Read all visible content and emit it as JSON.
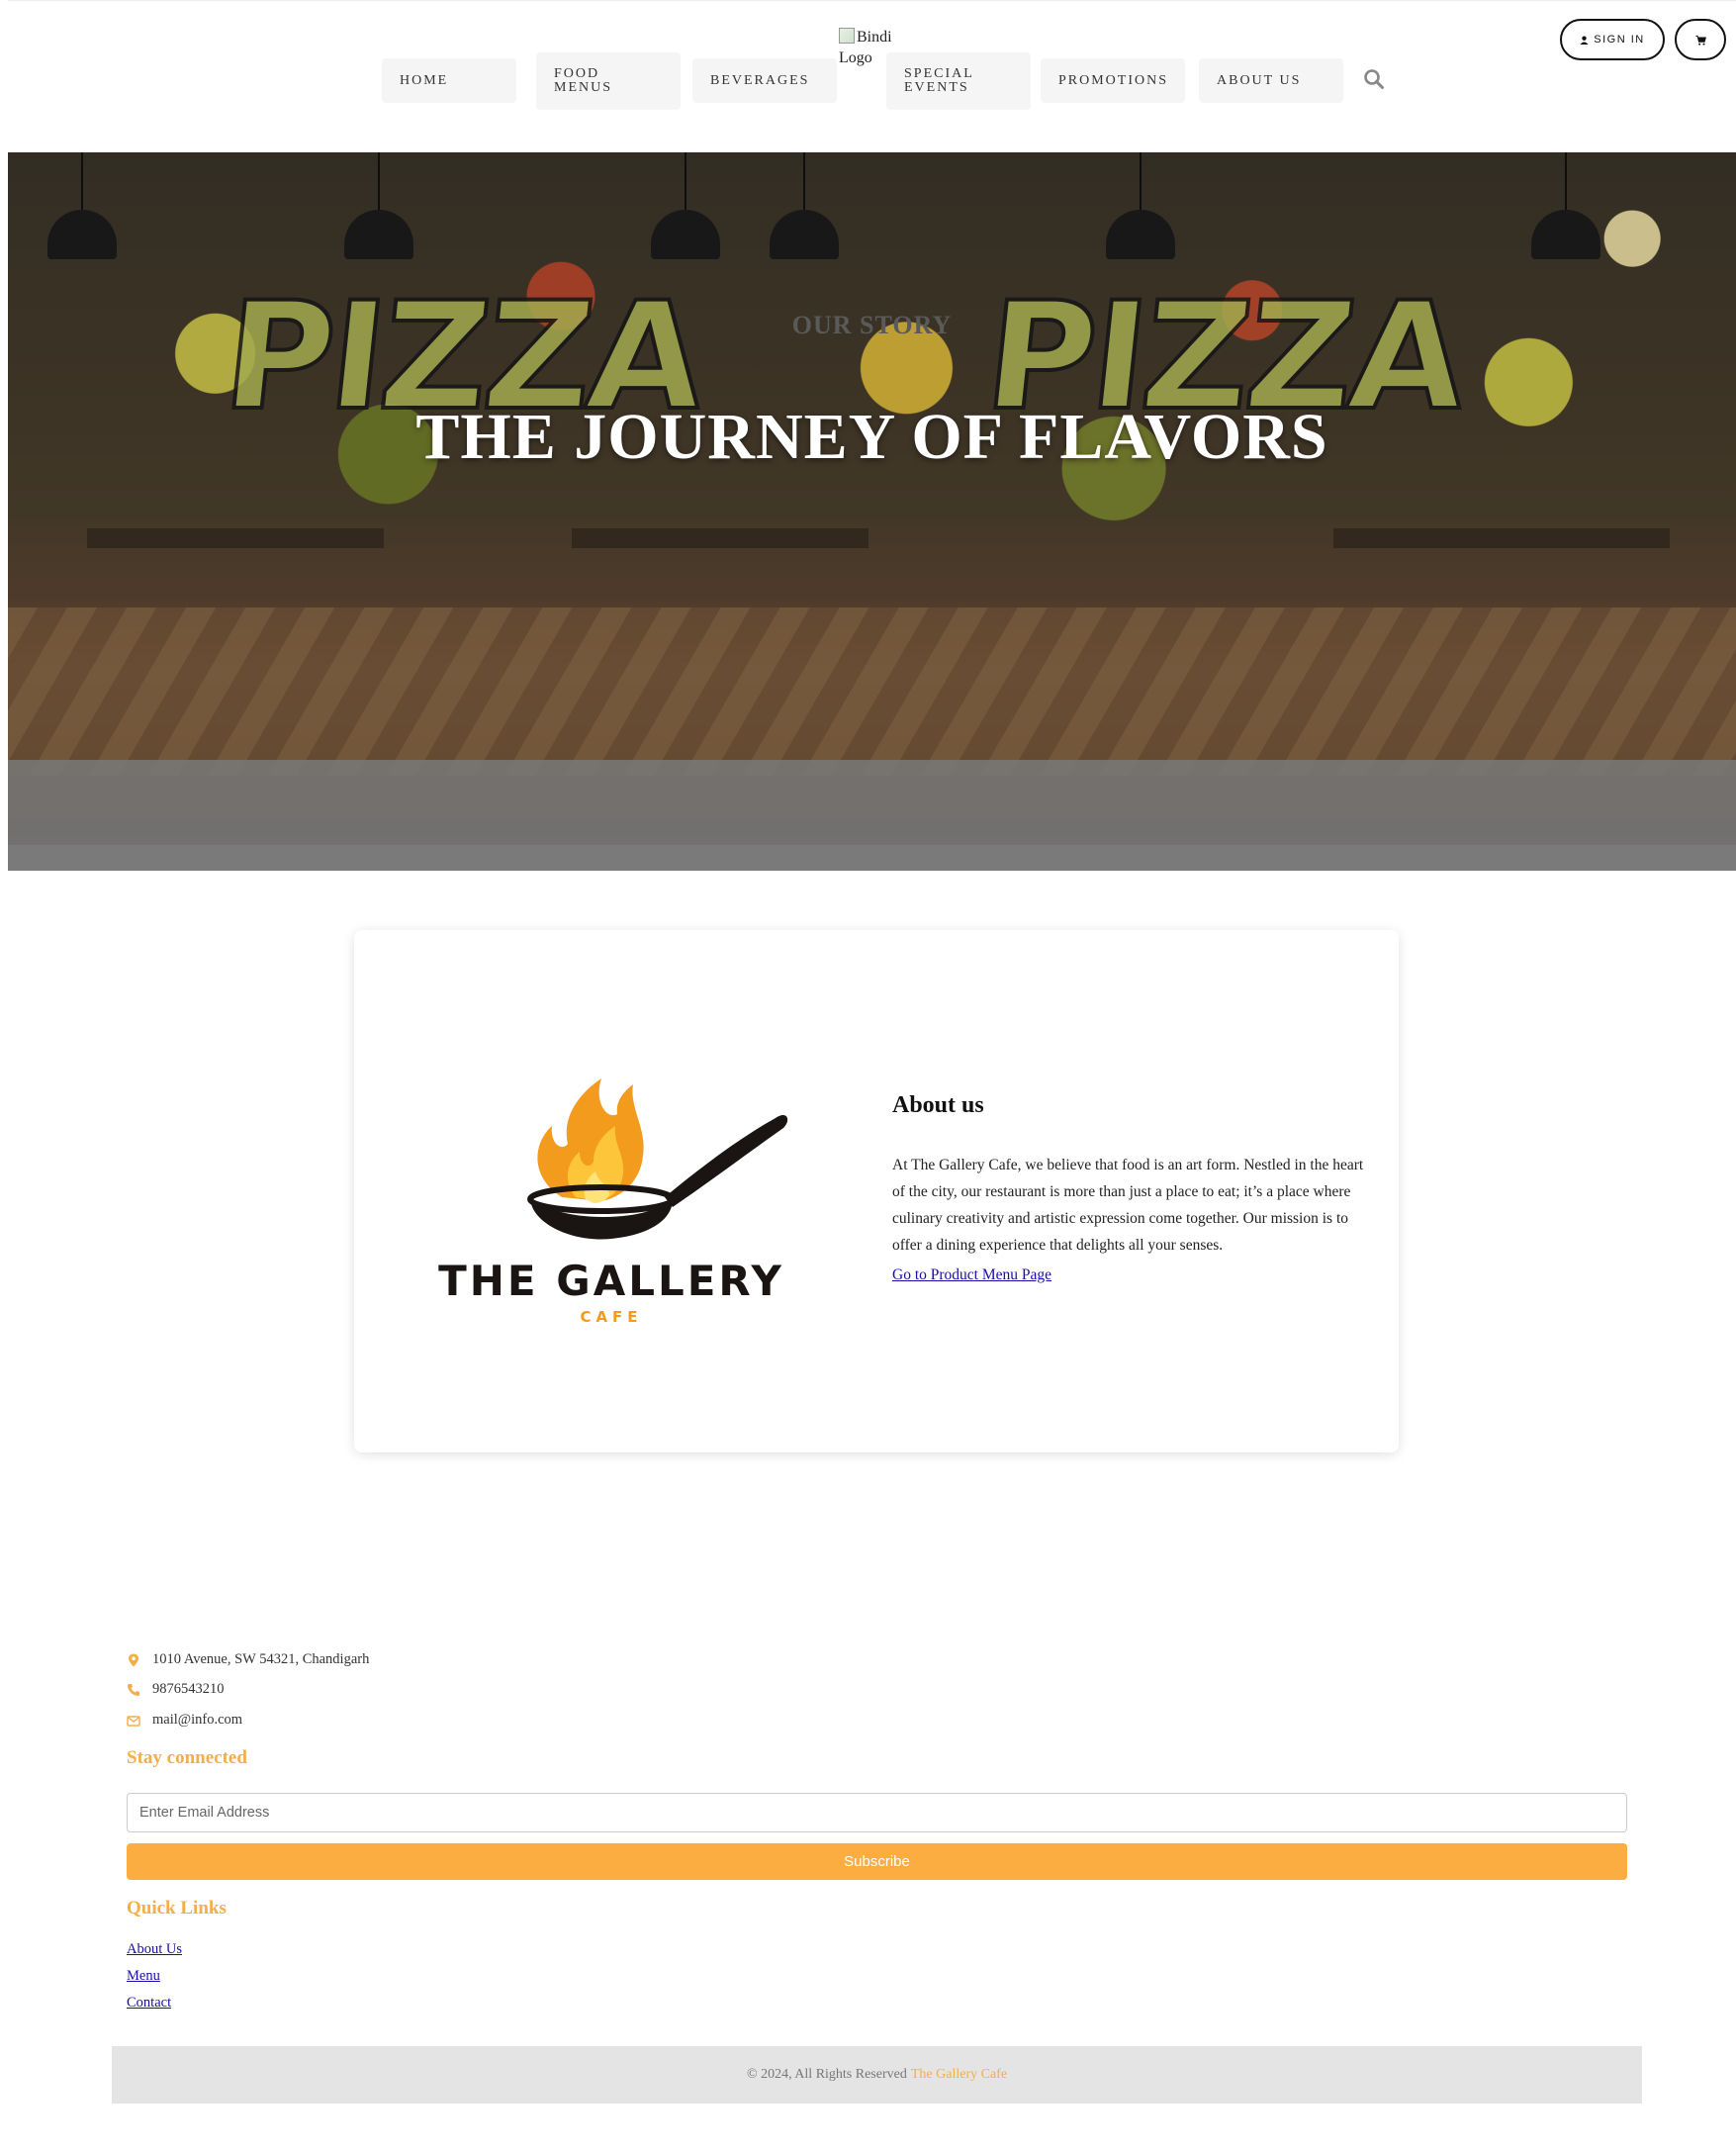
{
  "header": {
    "nav": [
      {
        "label": "HOME"
      },
      {
        "label": "FOOD MENUS"
      },
      {
        "label": "BEVERAGES"
      },
      {
        "label": "SPECIAL EVENTS"
      },
      {
        "label": "PROMOTIONS"
      },
      {
        "label": "ABOUT US"
      }
    ],
    "logo_alt": "Bindi Logo",
    "sign_in_label": "SIGN IN",
    "icons": {
      "search": "search-icon",
      "user": "user-icon",
      "cart": "cart-icon"
    }
  },
  "hero": {
    "subtitle": "OUR STORY",
    "title": "THE JOURNEY OF FLAVORS",
    "background_text": "PIZZA"
  },
  "about": {
    "brand_name": "THE GALLERY",
    "brand_sub": "CAFE",
    "heading": "About us",
    "text": "At The Gallery Cafe, we believe that food is an art form. Nestled in the heart of the city, our restaurant is more than just a place to eat; it’s a place where culinary creativity and artistic expression come together. Our mission is to offer a dining experience that delights all your senses.",
    "link": "Go to Product Menu Page"
  },
  "footer": {
    "address": "1010 Avenue, SW 54321, Chandigarh",
    "phone": "9876543210",
    "email": "mail@info.com",
    "stay_connected": "Stay connected",
    "email_placeholder": "Enter Email Address",
    "subscribe_label": "Subscribe",
    "quick_links_heading": "Quick Links",
    "quick_links": [
      {
        "label": "About Us"
      },
      {
        "label": "Menu"
      },
      {
        "label": "Contact"
      }
    ],
    "copyright": "© 2024, All Rights Reserved",
    "copyright_brand": "The Gallery Cafe"
  },
  "colors": {
    "accent": "#fbad42",
    "heading_accent": "#f3ae4a",
    "link": "#1a0dab",
    "nav_bg": "#f5f5f5"
  }
}
